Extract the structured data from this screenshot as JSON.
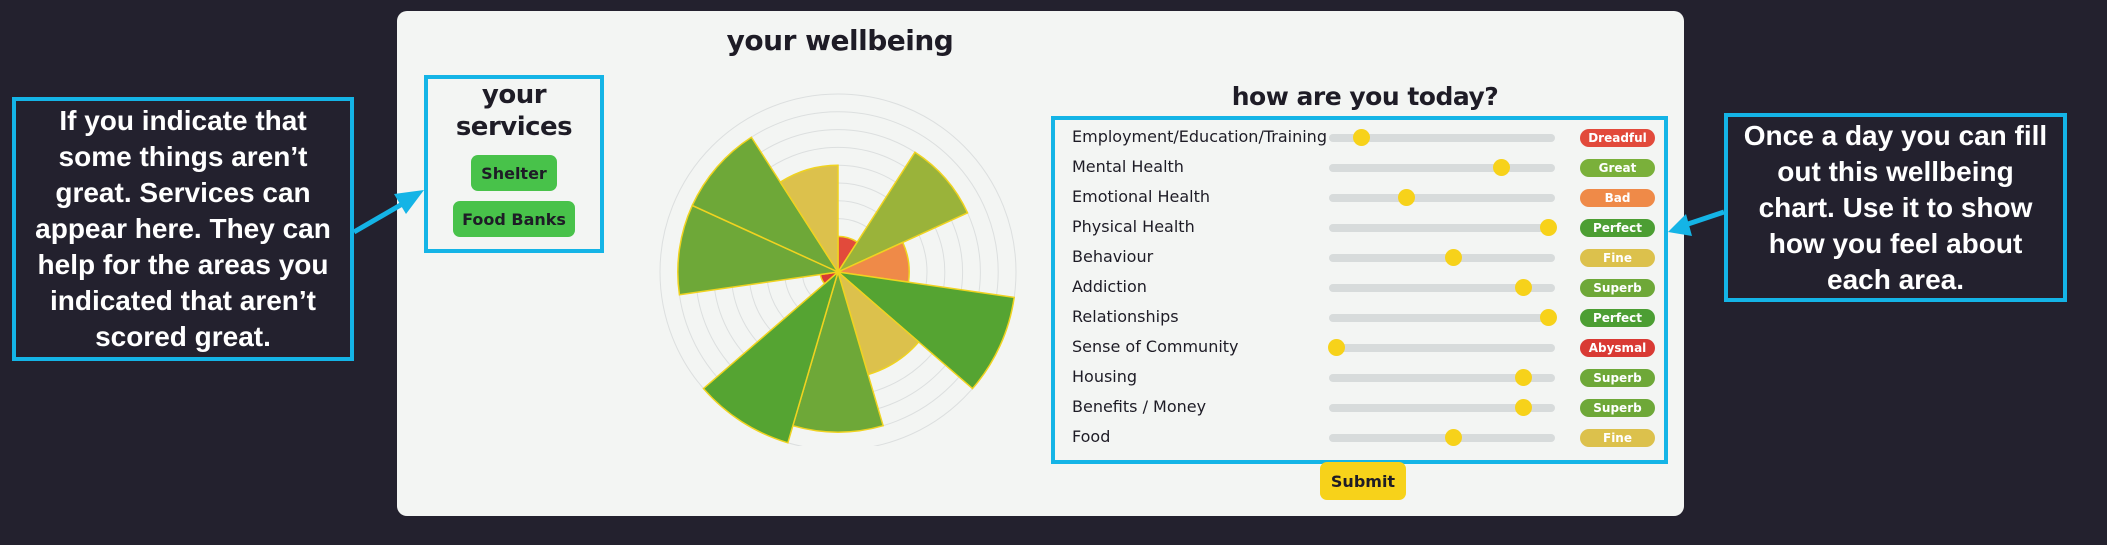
{
  "chart_title": "your wellbeing",
  "services": {
    "title_line1": "your",
    "title_line2": "services",
    "buttons": [
      "Shelter",
      "Food Banks"
    ]
  },
  "form": {
    "title": "how are you today?",
    "submit_label": "Submit",
    "rows": [
      {
        "label": "Employment/Education/Training",
        "value": 0.14,
        "rating": "Dreadful",
        "color": "#e24a3b"
      },
      {
        "label": "Mental Health",
        "value": 0.76,
        "rating": "Great",
        "color": "#7ab03a"
      },
      {
        "label": "Emotional Health",
        "value": 0.34,
        "rating": "Bad",
        "color": "#ef8a48"
      },
      {
        "label": "Physical Health",
        "value": 0.97,
        "rating": "Perfect",
        "color": "#4c9e33"
      },
      {
        "label": "Behaviour",
        "value": 0.55,
        "rating": "Fine",
        "color": "#dcc14c"
      },
      {
        "label": "Addiction",
        "value": 0.86,
        "rating": "Superb",
        "color": "#6ea838"
      },
      {
        "label": "Relationships",
        "value": 0.97,
        "rating": "Perfect",
        "color": "#4c9e33"
      },
      {
        "label": "Sense of Community",
        "value": 0.03,
        "rating": "Abysmal",
        "color": "#d93a34"
      },
      {
        "label": "Housing",
        "value": 0.86,
        "rating": "Superb",
        "color": "#6ea838"
      },
      {
        "label": "Benefits / Money",
        "value": 0.86,
        "rating": "Superb",
        "color": "#6ea838"
      },
      {
        "label": "Food",
        "value": 0.55,
        "rating": "Fine",
        "color": "#dcc14c"
      }
    ]
  },
  "callouts": {
    "left": "If you indicate that some things aren’t great. Services can appear here. They can help for the areas you indicated that aren’t scored great.",
    "right": "Once a day you can fill out this wellbeing chart. Use it to show how you feel about each area."
  },
  "colors": {
    "accent": "#14b4e6",
    "thumb": "#f7d21a",
    "service_button": "#48c24a",
    "background": "#23212e",
    "panel": "#f3f5f3"
  },
  "chart_data": {
    "type": "polar-area",
    "categories": [
      "Employment/Education/Training",
      "Mental Health",
      "Emotional Health",
      "Physical Health",
      "Behaviour",
      "Addiction",
      "Relationships",
      "Sense of Community",
      "Housing",
      "Benefits / Money",
      "Food"
    ],
    "values": [
      2,
      8,
      4,
      10,
      6,
      9,
      10,
      1,
      9,
      9,
      6
    ],
    "rlim": [
      0,
      10
    ],
    "colors": [
      "#e24a3b",
      "#9ab33a",
      "#ef8a48",
      "#55a432",
      "#dcc14c",
      "#6ea838",
      "#55a432",
      "#d93a34",
      "#6ea838",
      "#6ea838",
      "#dcc14c"
    ]
  }
}
